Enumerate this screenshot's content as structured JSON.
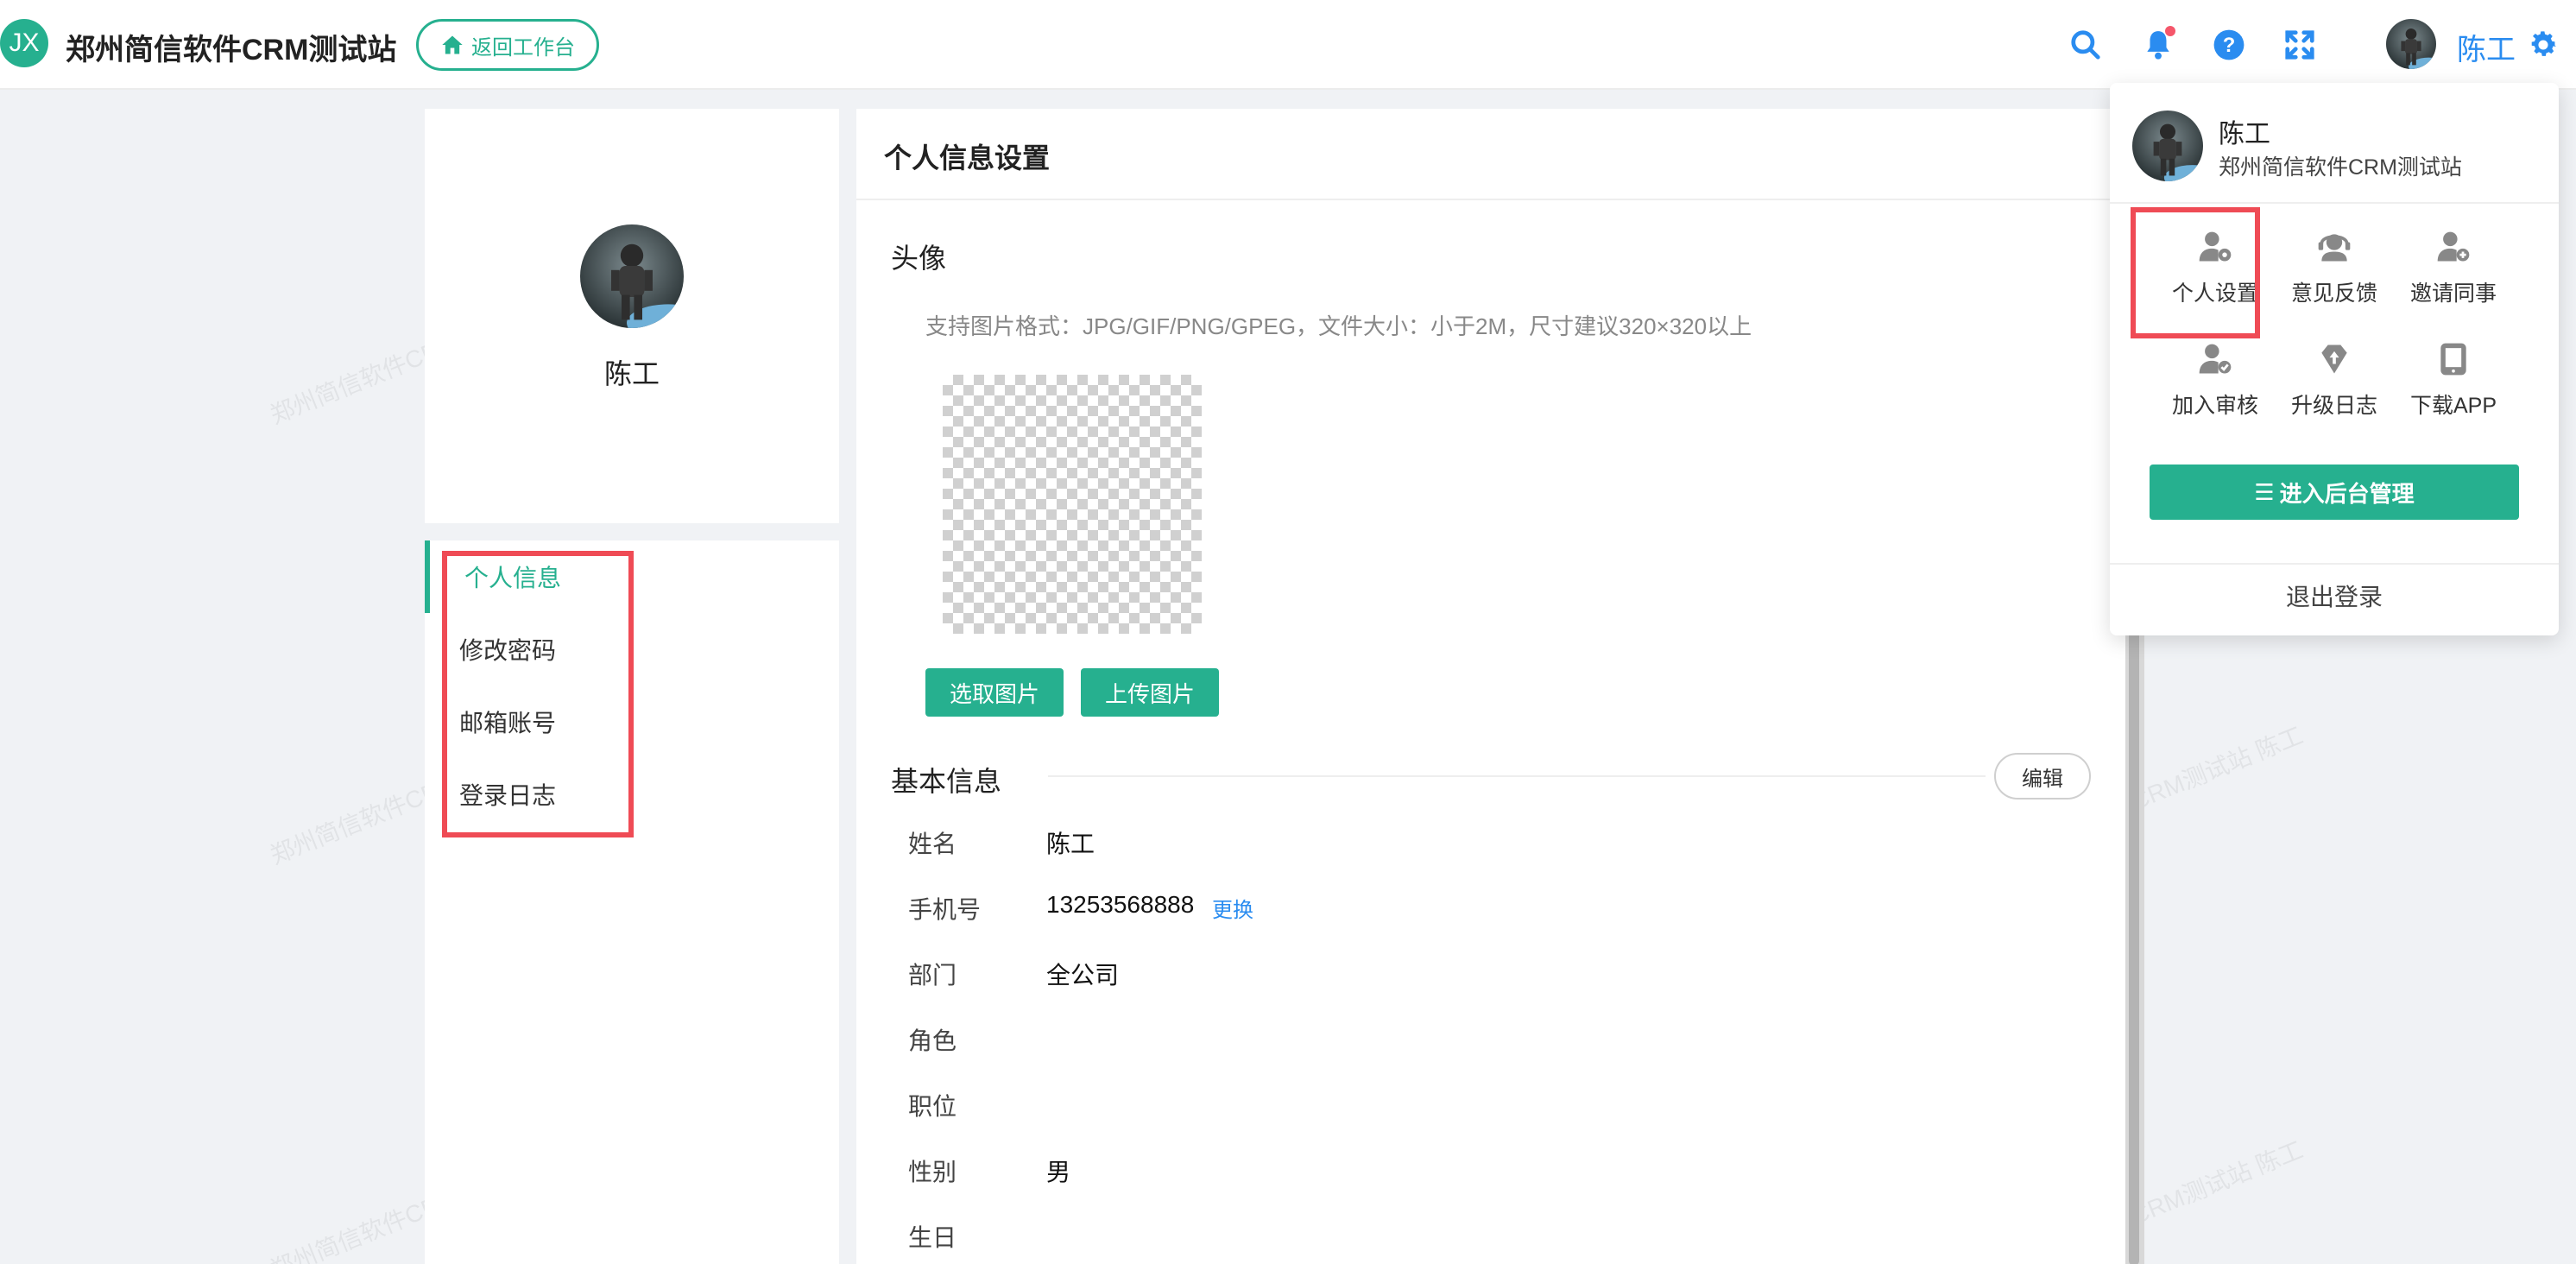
{
  "header": {
    "logo_text": "JX",
    "site_title": "郑州简信软件CRM测试站",
    "back_button": "返回工作台",
    "username": "陈工",
    "icons": [
      "search-icon",
      "bell-icon",
      "help-icon",
      "fullscreen-icon",
      "gear-icon"
    ]
  },
  "profile": {
    "name": "陈工"
  },
  "menu": {
    "items": [
      "个人信息",
      "修改密码",
      "邮箱账号",
      "登录日志"
    ],
    "active_index": 0
  },
  "main": {
    "title": "个人信息设置",
    "avatar_section": {
      "title": "头像",
      "hint": "支持图片格式：JPG/GIF/PNG/GPEG，文件大小：小于2M，尺寸建议320×320以上",
      "select_button": "选取图片",
      "upload_button": "上传图片"
    },
    "basic_section": {
      "title": "基本信息",
      "edit_button": "编辑",
      "change_link": "更换",
      "fields": [
        {
          "label": "姓名",
          "value": "陈工"
        },
        {
          "label": "手机号",
          "value": "13253568888"
        },
        {
          "label": "部门",
          "value": "全公司"
        },
        {
          "label": "角色",
          "value": ""
        },
        {
          "label": "职位",
          "value": ""
        },
        {
          "label": "性别",
          "value": "男"
        },
        {
          "label": "生日",
          "value": ""
        }
      ]
    }
  },
  "watermark": "郑州简信软件CRM测试站 陈工",
  "popup": {
    "name": "陈工",
    "site": "郑州简信软件CRM测试站",
    "items": [
      {
        "label": "个人设置",
        "icon": "user-settings-icon"
      },
      {
        "label": "意见反馈",
        "icon": "feedback-icon"
      },
      {
        "label": "邀请同事",
        "icon": "invite-user-icon"
      },
      {
        "label": "加入审核",
        "icon": "join-review-icon"
      },
      {
        "label": "升级日志",
        "icon": "upgrade-log-icon"
      },
      {
        "label": "下载APP",
        "icon": "download-app-icon"
      }
    ],
    "admin_button": "进入后台管理",
    "logout": "退出登录"
  },
  "colors": {
    "accent": "#26b08f",
    "link": "#2a8cf0",
    "highlight_box": "#ef4b55",
    "notification_dot": "#f5566a"
  }
}
